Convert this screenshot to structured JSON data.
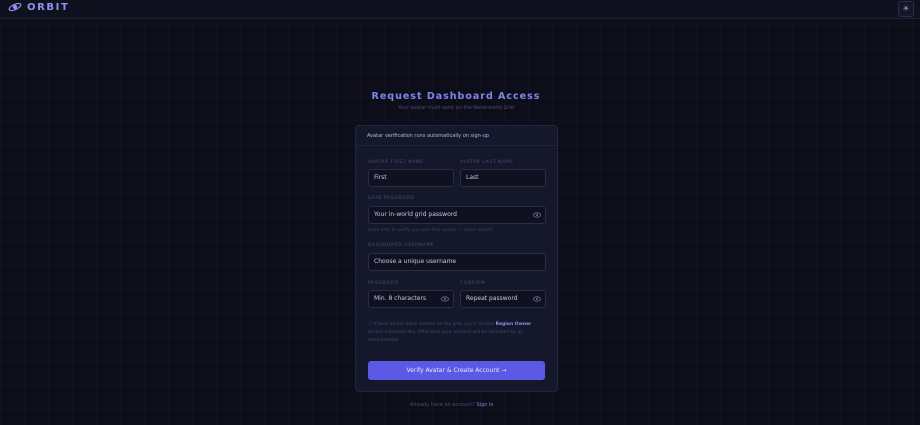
{
  "header": {
    "brand": "ORBIT",
    "theme_toggle_icon": "sun-icon",
    "theme_toggle_glyph": "☀"
  },
  "page": {
    "title": "Request Dashboard Access",
    "subtitle": "Your avatar must exist on the Neverworld Grid"
  },
  "form": {
    "notice": "Avatar verification runs automatically on sign-up",
    "first_name": {
      "label": "AVATAR FIRST NAME",
      "placeholder": "First"
    },
    "last_name": {
      "label": "AVATAR LAST NAME",
      "placeholder": "Last"
    },
    "grid_password": {
      "label": "GRID PASSWORD",
      "placeholder": "Your in-world grid password",
      "hint": "Used only to verify you own this avatar — never stored."
    },
    "username": {
      "label": "DASHBOARD USERNAME",
      "placeholder": "Choose a unique username"
    },
    "password": {
      "label": "PASSWORD",
      "placeholder": "Min. 8 characters"
    },
    "confirm": {
      "label": "CONFIRM",
      "placeholder": "Repeat password"
    },
    "info": {
      "icon": "info-icon",
      "prefix": "ⓘ If your avatar owns estates on the grid, you'll receive ",
      "highlight": "Region Owner",
      "suffix": " access automatically. Otherwise your account will be reviewed by an administrator."
    },
    "submit_label": "Verify Avatar & Create Account →"
  },
  "footer": {
    "prompt": "Already have an account?",
    "link": "Sign in"
  },
  "colors": {
    "accent": "#7f86ee",
    "button": "#5a5ae6",
    "background": "#0d0e1a",
    "card": "#15172a"
  }
}
